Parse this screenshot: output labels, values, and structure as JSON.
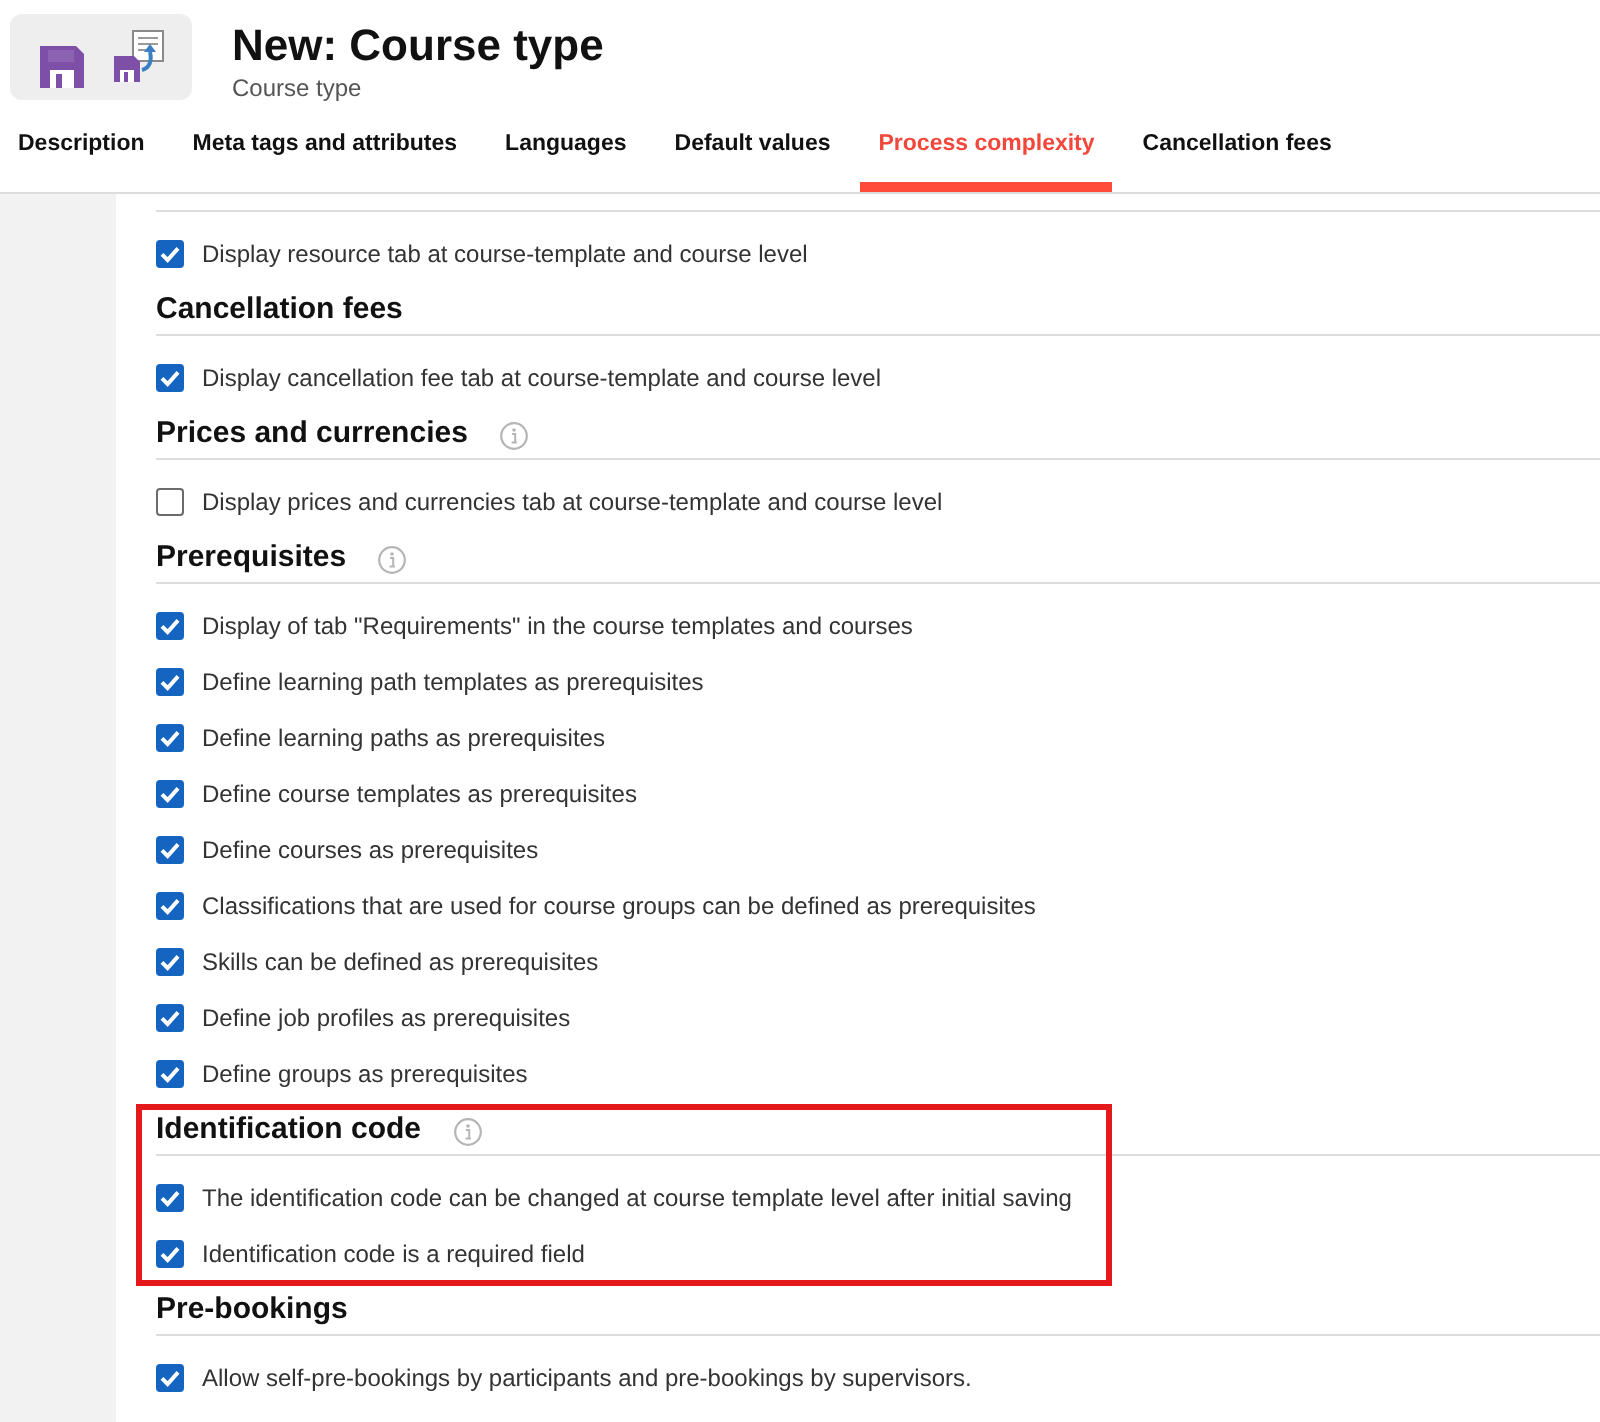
{
  "header": {
    "title": "New: Course type",
    "subtitle": "Course type"
  },
  "tabs": [
    {
      "label": "Description",
      "selected": false
    },
    {
      "label": "Meta tags and attributes",
      "selected": false
    },
    {
      "label": "Languages",
      "selected": false
    },
    {
      "label": "Default values",
      "selected": false
    },
    {
      "label": "Process complexity",
      "selected": true
    },
    {
      "label": "Cancellation fees",
      "selected": false
    }
  ],
  "sections": [
    {
      "info": false,
      "highlighted": false,
      "options": [
        {
          "label": "Display resource tab at course-template and course level",
          "checked": true
        }
      ]
    },
    {
      "title": "Cancellation fees",
      "info": false,
      "highlighted": false,
      "options": [
        {
          "label": "Display cancellation fee tab at course-template and course level",
          "checked": true
        }
      ]
    },
    {
      "title": "Prices and currencies",
      "info": true,
      "highlighted": false,
      "options": [
        {
          "label": "Display prices and currencies tab at course-template and course level",
          "checked": false
        }
      ]
    },
    {
      "title": "Prerequisites",
      "info": true,
      "highlighted": false,
      "options": [
        {
          "label": "Display of tab \"Requirements\" in the course templates and courses",
          "checked": true
        },
        {
          "label": "Define learning path templates as prerequisites",
          "checked": true
        },
        {
          "label": "Define learning paths as prerequisites",
          "checked": true
        },
        {
          "label": "Define course templates as prerequisites",
          "checked": true
        },
        {
          "label": "Define courses as prerequisites",
          "checked": true
        },
        {
          "label": "Classifications that are used for course groups can be defined as prerequisites",
          "checked": true
        },
        {
          "label": "Skills can be defined as prerequisites",
          "checked": true
        },
        {
          "label": "Define job profiles as prerequisites",
          "checked": true
        },
        {
          "label": "Define groups as prerequisites",
          "checked": true
        }
      ]
    },
    {
      "title": "Identification code",
      "info": true,
      "highlighted": true,
      "options": [
        {
          "label": "The identification code can be changed at course template level after initial saving",
          "checked": true
        },
        {
          "label": "Identification code is a required field",
          "checked": true
        }
      ]
    },
    {
      "title": "Pre-bookings",
      "info": false,
      "highlighted": false,
      "options": [
        {
          "label": "Allow self-pre-bookings by participants and pre-bookings by supervisors.",
          "checked": true
        }
      ]
    }
  ]
}
